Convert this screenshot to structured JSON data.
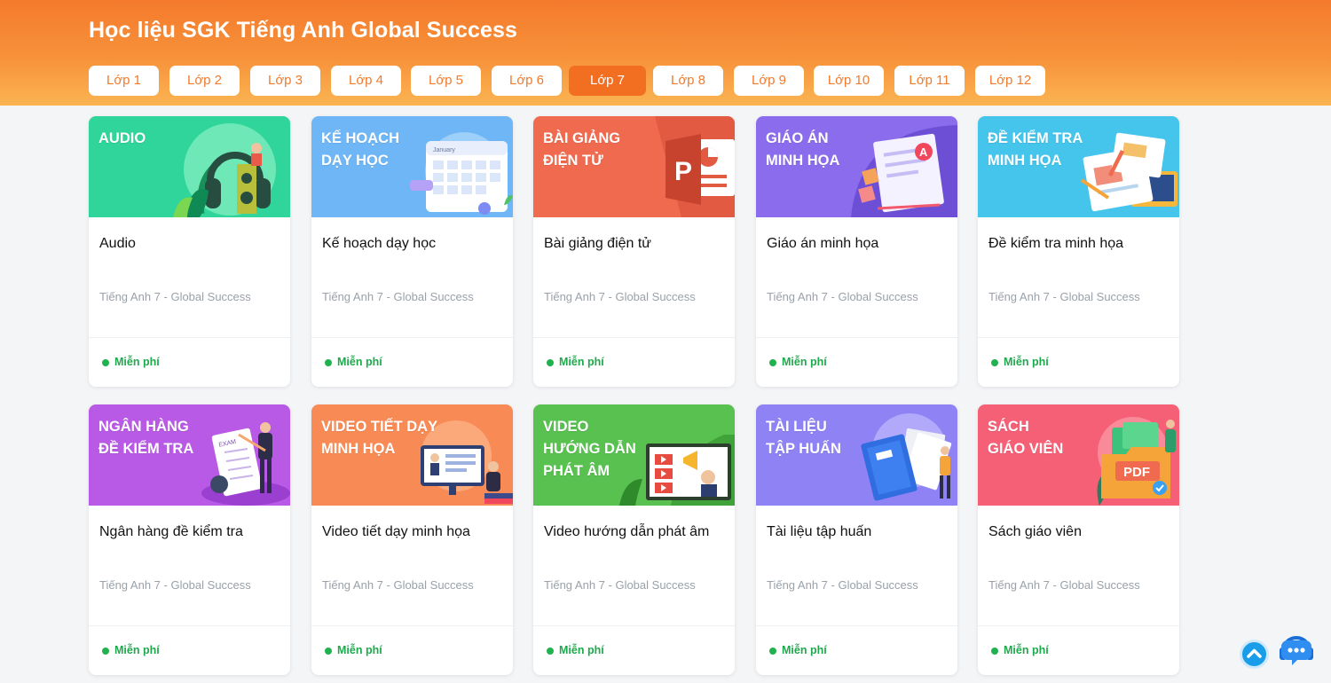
{
  "header": {
    "title": "Học liệu SGK Tiếng Anh Global Success"
  },
  "tabs": [
    {
      "label": "Lớp 1"
    },
    {
      "label": "Lớp 2"
    },
    {
      "label": "Lớp 3"
    },
    {
      "label": "Lớp 4"
    },
    {
      "label": "Lớp 5"
    },
    {
      "label": "Lớp 6"
    },
    {
      "label": "Lớp 7"
    },
    {
      "label": "Lớp 8"
    },
    {
      "label": "Lớp 9"
    },
    {
      "label": "Lớp 10"
    },
    {
      "label": "Lớp 11"
    },
    {
      "label": "Lớp 12"
    }
  ],
  "active_tab": "Lớp 7",
  "cards": [
    {
      "banner": "AUDIO",
      "title": "Audio",
      "subtitle": "Tiếng Anh 7 - Global Success",
      "badge": "Miễn phí",
      "color": "#2fd59a",
      "icon": "headphones-icon"
    },
    {
      "banner": "KẾ HOẠCH\nDẠY HỌC",
      "title": "Kế hoạch dạy học",
      "subtitle": "Tiếng Anh 7 - Global Success",
      "badge": "Miễn phí",
      "color": "#6fb6f6",
      "icon": "calendar-icon",
      "calendar_label": "January"
    },
    {
      "banner": "BÀI GIẢNG\nĐIỆN TỬ",
      "title": "Bài giảng điện tử",
      "subtitle": "Tiếng Anh 7 - Global Success",
      "badge": "Miễn phí",
      "color": "#f06a4f",
      "icon": "powerpoint-icon",
      "letter": "P"
    },
    {
      "banner": "GIÁO ÁN\nMINH HỌA",
      "title": "Giáo án minh họa",
      "subtitle": "Tiếng Anh 7 - Global Success",
      "badge": "Miễn phí",
      "color": "#8b6cec",
      "icon": "lesson-plan-icon",
      "letter": "A"
    },
    {
      "banner": "ĐỀ KIỂM TRA\nMINH HỌA",
      "title": "Đề kiểm tra minh họa",
      "subtitle": "Tiếng Anh 7 - Global Success",
      "badge": "Miễn phí",
      "color": "#45c4ec",
      "icon": "test-paper-icon"
    },
    {
      "banner": "NGÂN HÀNG\nĐỀ KIỂM TRA",
      "title": "Ngân hàng đề kiểm tra",
      "subtitle": "Tiếng Anh 7 - Global Success",
      "badge": "Miễn phí",
      "color": "#b95ae6",
      "icon": "exam-bank-icon",
      "exam_label": "EXAM"
    },
    {
      "banner": "VIDEO TIẾT DẠY\nMINH HỌA",
      "title": "Video tiết dạy minh họa",
      "subtitle": "Tiếng Anh 7 - Global Success",
      "badge": "Miễn phí",
      "color": "#f88b55",
      "icon": "video-lesson-icon"
    },
    {
      "banner": "VIDEO\nHƯỚNG DẪN\nPHÁT ÂM",
      "title": "Video hướng dẫn phát âm",
      "subtitle": "Tiếng Anh 7 - Global Success",
      "badge": "Miễn phí",
      "color": "#58c150",
      "icon": "pronunciation-video-icon"
    },
    {
      "banner": "TÀI LIỆU\nTẬP HUẤN",
      "title": "Tài liệu tập huấn",
      "subtitle": "Tiếng Anh 7 - Global Success",
      "badge": "Miễn phí",
      "color": "#8f82f5",
      "icon": "training-document-icon"
    },
    {
      "banner": "SÁCH\nGIÁO VIÊN",
      "title": "Sách giáo viên",
      "subtitle": "Tiếng Anh 7 - Global Success",
      "badge": "Miễn phí",
      "color": "#f56076",
      "icon": "pdf-folder-icon",
      "pdf_label": "PDF"
    }
  ],
  "floating": {
    "scroll_top_icon": "chevron-up-icon",
    "support_icon": "chat-support-icon"
  }
}
